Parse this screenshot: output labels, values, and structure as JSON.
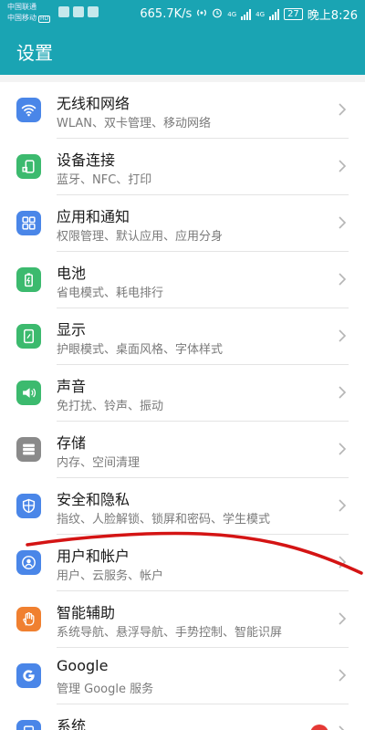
{
  "status_bar": {
    "carrier1": "中国联通",
    "carrier2": "中国移动",
    "hd": "HD",
    "network_speed": "665.7K/s",
    "network_type1": "4G",
    "network_type2": "4G",
    "battery": "27",
    "time": "晚上8:26"
  },
  "app_bar": {
    "title": "设置"
  },
  "settings": [
    {
      "title": "无线和网络",
      "subtitle": "WLAN、双卡管理、移动网络",
      "icon": "wifi-icon",
      "color": "#4a86e8"
    },
    {
      "title": "设备连接",
      "subtitle": "蓝牙、NFC、打印",
      "icon": "device-connect-icon",
      "color": "#3cba6e"
    },
    {
      "title": "应用和通知",
      "subtitle": "权限管理、默认应用、应用分身",
      "icon": "apps-grid-icon",
      "color": "#4a86e8"
    },
    {
      "title": "电池",
      "subtitle": "省电模式、耗电排行",
      "icon": "battery-icon",
      "color": "#3cba6e"
    },
    {
      "title": "显示",
      "subtitle": "护眼模式、桌面风格、字体样式",
      "icon": "display-icon",
      "color": "#3cba6e"
    },
    {
      "title": "声音",
      "subtitle": "免打扰、铃声、振动",
      "icon": "speaker-icon",
      "color": "#3cba6e"
    },
    {
      "title": "存储",
      "subtitle": "内存、空间清理",
      "icon": "storage-icon",
      "color": "#8a8a8a"
    },
    {
      "title": "安全和隐私",
      "subtitle": "指纹、人脸解锁、锁屏和密码、学生模式",
      "icon": "shield-icon",
      "color": "#4a86e8"
    },
    {
      "title": "用户和帐户",
      "subtitle": "用户、云服务、帐户",
      "icon": "user-icon",
      "color": "#4a86e8"
    },
    {
      "title": "智能辅助",
      "subtitle": "系统导航、悬浮导航、手势控制、智能识屏",
      "icon": "hand-icon",
      "color": "#f08030"
    },
    {
      "title": "Google",
      "subtitle": "管理 Google 服务",
      "icon": "google-icon",
      "color": "#4a86e8"
    },
    {
      "title": "系统",
      "subtitle": "",
      "icon": "system-icon",
      "color": "#4a86e8"
    }
  ]
}
